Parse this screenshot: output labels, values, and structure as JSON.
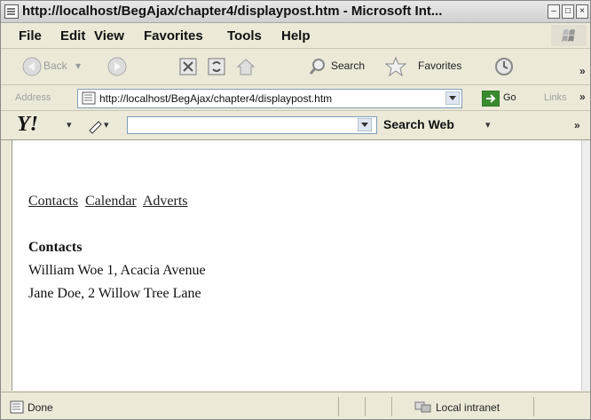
{
  "window": {
    "title": "http://localhost/BegAjax/chapter4/displaypost.htm - Microsoft Int...",
    "minimize": "–",
    "maximize": "□",
    "close": "×"
  },
  "menu": [
    "File",
    "Edit",
    "View",
    "Favorites",
    "Tools",
    "Help"
  ],
  "toolbar": {
    "back": "Back",
    "search": "Search",
    "favorites": "Favorites",
    "more": "»"
  },
  "address": {
    "label": "Address",
    "url": "http://localhost/BegAjax/chapter4/displaypost.htm",
    "go": "Go",
    "links": "Links",
    "more": "»"
  },
  "yahoo": {
    "logo": "Y!",
    "search_button": "Search Web",
    "more": "»"
  },
  "page": {
    "nav": [
      "Contacts",
      "Calendar",
      "Adverts"
    ],
    "contacts_title": "Contacts",
    "contacts": [
      "William Woe 1, Acacia Avenue",
      "Jane Doe, 2 Willow Tree Lane"
    ]
  },
  "status": {
    "text": "Done",
    "zone": "Local intranet"
  },
  "colors": {
    "go_button": "#3a8a2e",
    "yahoo_logo": "#111111"
  }
}
